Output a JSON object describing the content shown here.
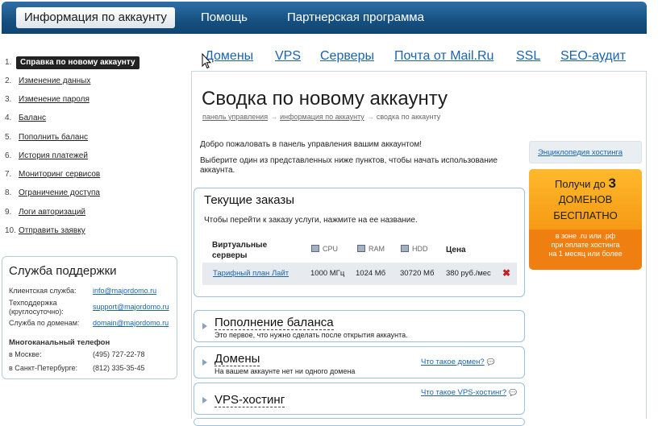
{
  "topnav": {
    "tabs": [
      {
        "label": "Информация по аккаунту"
      },
      {
        "label": "Помощь"
      },
      {
        "label": "Партнерская программа"
      }
    ]
  },
  "services": [
    "Домены",
    "VPS",
    "Серверы",
    "Почта от Mail.Ru",
    "SSL",
    "SEO-аудит"
  ],
  "sidebar": {
    "items": [
      {
        "num": "1.",
        "label": "Справка по новому аккаунту"
      },
      {
        "num": "2.",
        "label": "Изменение данных"
      },
      {
        "num": "3.",
        "label": "Изменение пароля"
      },
      {
        "num": "4.",
        "label": "Баланс"
      },
      {
        "num": "5.",
        "label": "Пополнить баланс"
      },
      {
        "num": "6.",
        "label": "История платежей"
      },
      {
        "num": "7.",
        "label": "Мониторинг сервисов"
      },
      {
        "num": "8.",
        "label": "Ограничение доступа"
      },
      {
        "num": "9.",
        "label": "Логи авторизаций"
      },
      {
        "num": "10.",
        "label": "Отправить заявку"
      }
    ]
  },
  "support": {
    "title": "Служба поддержки",
    "client_label": "Клиентская служба:",
    "client_email": "info@majordomo.ru",
    "tech_label": "Техподдержка (круглосуточно):",
    "tech_email": "support@majordomo.ru",
    "domain_label": "Служба по доменам:",
    "domain_email": "domain@majordomo.ru",
    "phone_title": "Многоканальный телефон",
    "moscow_label": "в Москве:",
    "moscow_phone": "(495) 727-22-78",
    "spb_label": "в Санкт-Петербурге:",
    "spb_phone": "(812) 335-35-45"
  },
  "main": {
    "title": "Сводка по новому аккаунту",
    "breadcrumb": [
      "панель управления",
      "информация по аккаунту",
      "сводка по аккаунту"
    ],
    "welcome": "Добро пожаловать в панель управления вашим аккаунтом!",
    "choose": "Выберите один из представленных ниже пунктов, чтобы начать использование аккаунта."
  },
  "orders": {
    "title": "Текущие заказы",
    "hint": "Чтобы перейти к заказу услуги, нажмите на ее название.",
    "group_label": "Виртуальные серверы",
    "columns": [
      "CPU",
      "RAM",
      "HDD",
      "Цена"
    ],
    "row": {
      "plan": "Тарифный план Лайт",
      "cpu": "1000 МГц",
      "ram": "1024 Мб",
      "hdd": "30720 Мб",
      "price": "380 руб./мес",
      "delete": "✖"
    }
  },
  "accordion": [
    {
      "title": "Пополнение баланса",
      "desc": "Это первое, что нужно сделать после открытия аккаунта.",
      "question": ""
    },
    {
      "title": "Домены",
      "desc": "На вашем аккаунте нет ни одного домена",
      "question": "Что такое домен?"
    },
    {
      "title": "VPS-хостинг",
      "desc": "",
      "question": "Что такое VPS-хостинг?"
    }
  ],
  "right": {
    "encyclopedia": "Энциклопедия хостинга",
    "promo_line1": "Получи до",
    "promo_num": "3",
    "promo_line2": "ДОМЕНОВ",
    "promo_line3": "БЕСПЛАТНО",
    "promo_s1": "в зоне .ru или .рф",
    "promo_s2": "при оплате хостинга",
    "promo_s3": "на 1 месяц или более"
  }
}
